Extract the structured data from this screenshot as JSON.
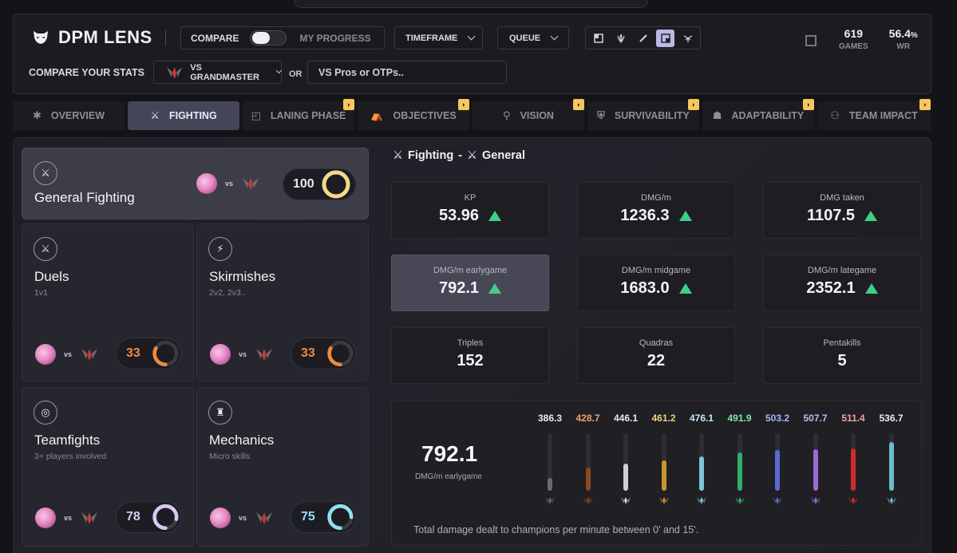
{
  "app": {
    "title": "DPM LENS"
  },
  "header": {
    "compare_label": "COMPARE",
    "progress_label": "MY PROGRESS",
    "timeframe_label": "TIMEFRAME",
    "queue_label": "QUEUE",
    "games_value": "619",
    "games_label": "GAMES",
    "wr_value": "56.4",
    "wr_unit": "%",
    "wr_label": "WR",
    "compare_your_stats": "COMPARE YOUR STATS",
    "vs_selected": "VS GRANDMASTER",
    "or_label": "OR",
    "search_value": "VS Pros or OTPs.."
  },
  "tabs": [
    {
      "label": "OVERVIEW",
      "icon": "asterisk-icon"
    },
    {
      "label": "FIGHTING",
      "icon": "swords-icon",
      "active": true
    },
    {
      "label": "LANING PHASE",
      "icon": "lane-icon",
      "locked": true
    },
    {
      "label": "OBJECTIVES",
      "icon": "objective-icon",
      "locked": true
    },
    {
      "label": "VISION",
      "icon": "ward-icon",
      "locked": true
    },
    {
      "label": "SURVIVABILITY",
      "icon": "shield-icon",
      "locked": true
    },
    {
      "label": "ADAPTABILITY",
      "icon": "mask-icon",
      "locked": true
    },
    {
      "label": "TEAM IMPACT",
      "icon": "team-icon",
      "locked": true
    }
  ],
  "categories": {
    "general": {
      "name": "General Fighting",
      "vs": "vs",
      "score": "100",
      "score_frac": 1.0,
      "color": "#f4d98a"
    },
    "duels": {
      "name": "Duels",
      "sub": "1v1",
      "vs": "vs",
      "score": "33",
      "score_frac": 0.33,
      "color": "#f08a3c"
    },
    "skirmishes": {
      "name": "Skirmishes",
      "sub": "2v2, 2v3..",
      "vs": "vs",
      "score": "33",
      "score_frac": 0.33,
      "color": "#f08a3c"
    },
    "teamfights": {
      "name": "Teamfights",
      "sub": "3+ players involved",
      "vs": "vs",
      "score": "78",
      "score_frac": 0.78,
      "color": "#d9c8f4"
    },
    "mechanics": {
      "name": "Mechanics",
      "sub": "Micro skills",
      "vs": "vs",
      "score": "75",
      "score_frac": 0.75,
      "color": "#8fe0f4"
    }
  },
  "section": {
    "title_a": "Fighting",
    "sep": "-",
    "title_b": "General"
  },
  "metrics": [
    {
      "label": "KP",
      "value": "53.96"
    },
    {
      "label": "DMG/m",
      "value": "1236.3"
    },
    {
      "label": "DMG taken",
      "value": "1107.5"
    },
    {
      "label": "DMG/m earlygame",
      "value": "792.1"
    },
    {
      "label": "DMG/m midgame",
      "value": "1683.0"
    },
    {
      "label": "DMG/m lategame",
      "value": "2352.1"
    },
    {
      "label": "Triples",
      "value": "152"
    },
    {
      "label": "Quadras",
      "value": "22"
    },
    {
      "label": "Pentakills",
      "value": "5"
    }
  ],
  "distribution": {
    "value": "792.1",
    "label": "DMG/m earlygame",
    "description": "Total damage dealt to champions per minute between 0' and 15'.",
    "bars": [
      {
        "value": "386.3",
        "num": 386.3,
        "color": "#6a6a70",
        "text_color": "#e8e8ee"
      },
      {
        "value": "428.7",
        "num": 428.7,
        "color": "#8a4a20",
        "text_color": "#f0a070"
      },
      {
        "value": "446.1",
        "num": 446.1,
        "color": "#cfcfd6",
        "text_color": "#e8e8ee"
      },
      {
        "value": "461.2",
        "num": 461.2,
        "color": "#c8962c",
        "text_color": "#f0d080"
      },
      {
        "value": "476.1",
        "num": 476.1,
        "color": "#7fc4d6",
        "text_color": "#c0e8f4"
      },
      {
        "value": "491.9",
        "num": 491.9,
        "color": "#2fae6a",
        "text_color": "#80e0a8"
      },
      {
        "value": "503.2",
        "num": 503.2,
        "color": "#5a6ad0",
        "text_color": "#a8b4f4"
      },
      {
        "value": "507.7",
        "num": 507.7,
        "color": "#9a6ad0",
        "text_color": "#d0b0f4"
      },
      {
        "value": "511.4",
        "num": 511.4,
        "color": "#d02a2a",
        "text_color": "#f4a0a0"
      },
      {
        "value": "536.7",
        "num": 536.7,
        "color": "#6abcd0",
        "text_color": "#e8e8ee"
      }
    ]
  }
}
